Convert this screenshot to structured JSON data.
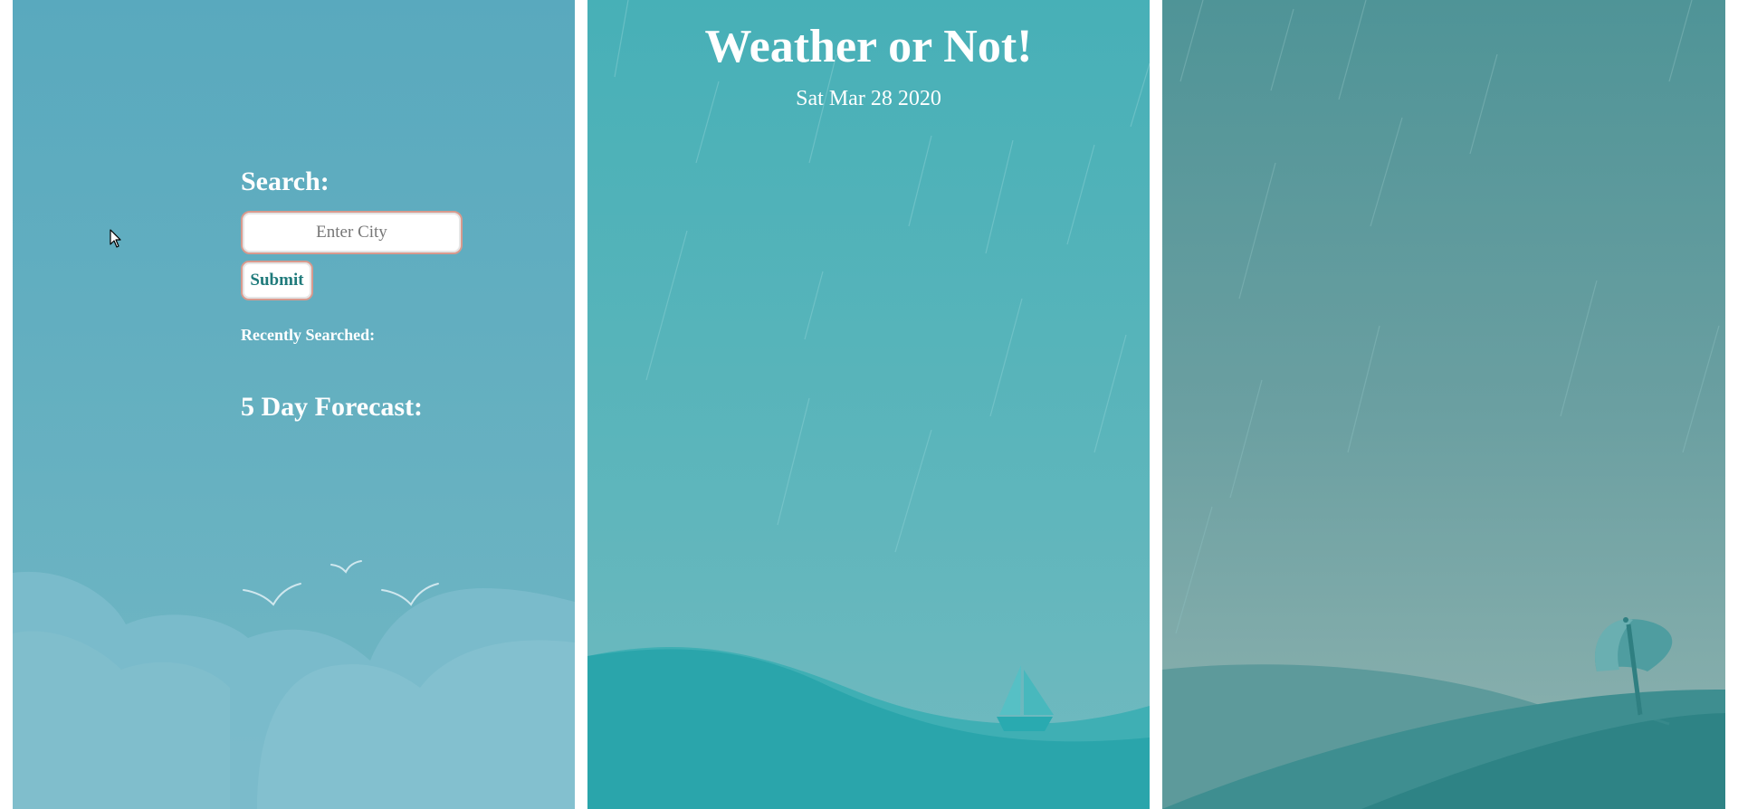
{
  "app": {
    "title": "Weather or Not!",
    "date": "Sat Mar 28 2020"
  },
  "search": {
    "title": "Search:",
    "placeholder": "Enter City",
    "value": "",
    "submit_label": "Submit"
  },
  "recent": {
    "title": "Recently Searched:",
    "items": []
  },
  "forecast": {
    "title": "5 Day Forecast:",
    "days": []
  },
  "colors": {
    "left_panel": "#5faebf",
    "middle_panel": "#4fb2b8",
    "right_panel": "#6a9fa1",
    "button_text": "#1f7a7b",
    "input_border": "#d89a8e"
  },
  "icons": [
    "mouse-cursor-icon"
  ]
}
